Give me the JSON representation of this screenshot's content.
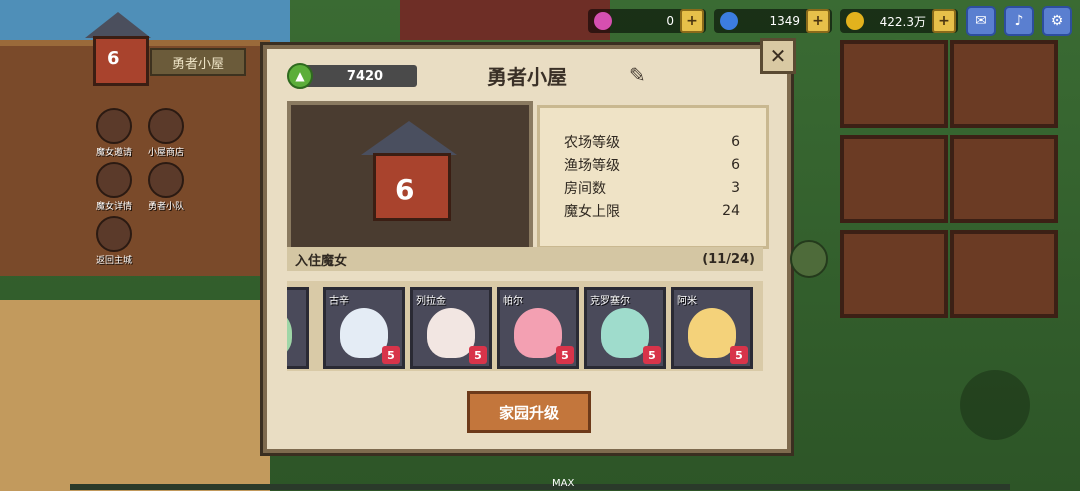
{
  "top_bar": {
    "resources": [
      {
        "icon": "pink-gem-icon",
        "value": "0",
        "color": "#d64fb0"
      },
      {
        "icon": "blue-gem-icon",
        "value": "1349",
        "color": "#3c7de0"
      },
      {
        "icon": "gold-coin-icon",
        "value": "422.3万",
        "color": "#e2b21d"
      }
    ],
    "buttons": [
      "mail-icon",
      "speaker-icon",
      "gear-icon"
    ]
  },
  "left": {
    "hut_level": "6",
    "hut_label": "勇者小屋",
    "menu": [
      "魔女邀请",
      "小屋商店",
      "魔女详情",
      "勇者小队",
      "返回主城"
    ]
  },
  "panel": {
    "score": "7420",
    "title": "勇者小屋",
    "house_level": "6",
    "stats": [
      {
        "label": "农场等级",
        "value": "6"
      },
      {
        "label": "渔场等级",
        "value": "6"
      },
      {
        "label": "房间数",
        "value": "3"
      },
      {
        "label": "魔女上限",
        "value": "24"
      }
    ],
    "residents_label": "入住魔女",
    "residents_count": "(11/24)",
    "witches": [
      {
        "name": "古辛",
        "level": "5",
        "color": "#e4ecf5"
      },
      {
        "name": "列拉金",
        "level": "5",
        "color": "#f2e6e2"
      },
      {
        "name": "帕尔",
        "level": "5",
        "color": "#f3a0b2"
      },
      {
        "name": "克罗塞尔",
        "level": "5",
        "color": "#9fdccc"
      },
      {
        "name": "阿米",
        "level": "5",
        "color": "#f4d27a"
      }
    ],
    "upgrade_button": "家园升级"
  },
  "bottom": {
    "max_label": "MAX"
  }
}
